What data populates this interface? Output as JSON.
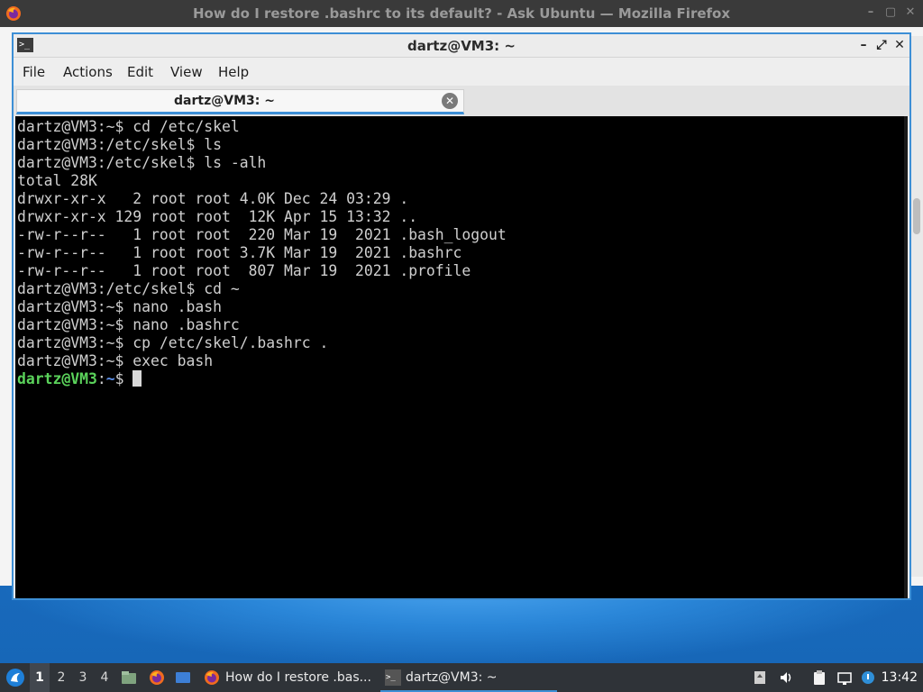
{
  "firefox": {
    "title": "How do I restore .bashrc to its default? - Ask Ubuntu — Mozilla Firefox",
    "icon": "firefox-icon",
    "controls": [
      "minimize-icon",
      "maximize-icon",
      "close-icon"
    ]
  },
  "terminal_window": {
    "title": "dartz@VM3: ~",
    "icon": "terminal-icon",
    "controls": {
      "minimize": "–",
      "maximize": "⤢",
      "close": "✕"
    },
    "menu": [
      "File",
      "Actions",
      "Edit",
      "View",
      "Help"
    ],
    "tab": {
      "label": "dartz@VM3: ~",
      "close_icon": "tab-close-icon"
    }
  },
  "terminal": {
    "lines": [
      "dartz@VM3:~$ cd /etc/skel",
      "dartz@VM3:/etc/skel$ ls",
      "dartz@VM3:/etc/skel$ ls -alh",
      "total 28K",
      "drwxr-xr-x   2 root root 4.0K Dec 24 03:29 .",
      "drwxr-xr-x 129 root root  12K Apr 15 13:32 ..",
      "-rw-r--r--   1 root root  220 Mar 19  2021 .bash_logout",
      "-rw-r--r--   1 root root 3.7K Mar 19  2021 .bashrc",
      "-rw-r--r--   1 root root  807 Mar 19  2021 .profile",
      "dartz@VM3:/etc/skel$ cd ~",
      "dartz@VM3:~$ nano .bash",
      "dartz@VM3:~$ nano .bashrc",
      "dartz@VM3:~$ cp /etc/skel/.bashrc .",
      "dartz@VM3:~$ exec bash"
    ],
    "final_prompt": {
      "user_host": "dartz@VM3",
      "sep": ":",
      "path": "~",
      "symbol": "$"
    }
  },
  "taskbar": {
    "start_icon": "lubuntu-start-icon",
    "workspaces": [
      "1",
      "2",
      "3",
      "4"
    ],
    "active_workspace": "1",
    "launchers": [
      "file-manager-icon",
      "firefox-icon",
      "desktop-icon"
    ],
    "tasks": [
      {
        "label": "How do I restore .bas...",
        "icon": "firefox-icon"
      },
      {
        "label": "dartz@VM3: ~",
        "icon": "terminal-icon",
        "active": true
      }
    ],
    "tray": [
      "updates-icon",
      "volume-icon",
      "clipboard-icon",
      "network-icon",
      "notification-icon"
    ],
    "clock": "13:42"
  },
  "colors": {
    "accent": "#3d8fd6",
    "prompt_green": "#5bd35b",
    "prompt_blue": "#5b8fe8",
    "terminal_bg": "#000000"
  }
}
